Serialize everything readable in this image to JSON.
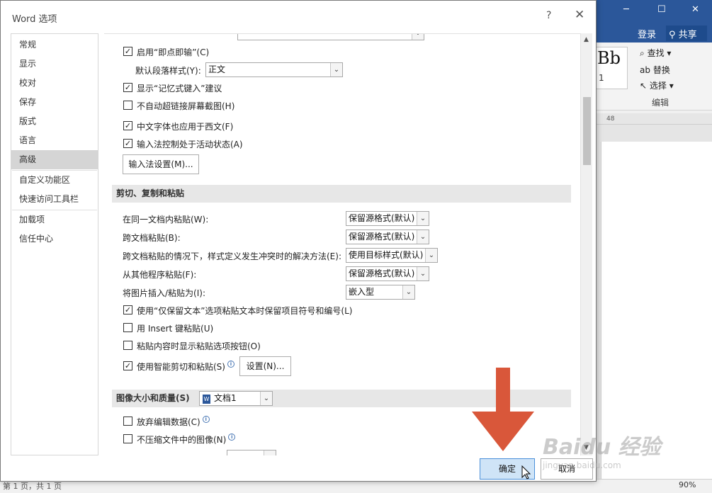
{
  "background_window": {
    "login_label": "登录",
    "share_label": "共享",
    "style_preview": "Bb",
    "style_preview_sub": "1",
    "find_label": "查找",
    "replace_label": "替换",
    "select_label": "选择",
    "edit_group_label": "编辑",
    "ruler_mark": "48",
    "zoom_level": "90%",
    "status_text": "第 1 页，共 1 页"
  },
  "dialog": {
    "title": "Word 选项",
    "help_glyph": "?",
    "close_glyph": "✕"
  },
  "nav": {
    "items": [
      {
        "label": "常规"
      },
      {
        "label": "显示"
      },
      {
        "label": "校对"
      },
      {
        "label": "保存"
      },
      {
        "label": "版式"
      },
      {
        "label": "语言"
      },
      {
        "label": "高级"
      },
      {
        "label": "自定义功能区"
      },
      {
        "label": "快速访问工具栏"
      },
      {
        "label": "加载项"
      },
      {
        "label": "信任中心"
      }
    ],
    "active_index": 6
  },
  "editing": {
    "click_and_type_label": "启用“即点即输”(C)",
    "default_para_style_label": "默认段落样式(Y):",
    "default_para_style_value": "正文",
    "autocomplete_label": "显示“记忆式键入”建议",
    "no_screenshot_hyperlink_label": "不自动超链接屏幕截图(H)",
    "chinese_font_western_label": "中文字体也应用于西文(F)",
    "ime_control_label": "输入法控制处于活动状态(A)",
    "ime_settings_button": "输入法设置(M)..."
  },
  "cut_copy_paste": {
    "section_title": "剪切、复制和粘贴",
    "rows": [
      {
        "label": "在同一文档内粘贴(W):",
        "value": "保留源格式(默认)"
      },
      {
        "label": "跨文档粘贴(B):",
        "value": "保留源格式(默认)"
      },
      {
        "label": "跨文档粘贴的情况下，样式定义发生冲突时的解决方法(E):",
        "value": "使用目标样式(默认)"
      },
      {
        "label": "从其他程序粘贴(F):",
        "value": "保留源格式(默认)"
      },
      {
        "label": "将图片插入/粘贴为(I):",
        "value": "嵌入型"
      }
    ],
    "keep_bullets_label": "使用“仅保留文本”选项粘贴文本时保留项目符号和编号(L)",
    "insert_key_paste_label": "用 Insert 键粘贴(U)",
    "show_paste_options_label": "粘贴内容时显示粘贴选项按钮(O)",
    "smart_cut_paste_label": "使用智能剪切和粘贴(S)",
    "settings_button": "设置(N)..."
  },
  "image_quality": {
    "section_title": "图像大小和质量(S)",
    "document_value": "文档1",
    "discard_edit_data_label": "放弃编辑数据(C)",
    "no_compress_label": "不压缩文件中的图像(N)"
  },
  "footer": {
    "ok_label": "确定",
    "cancel_label": "取消"
  },
  "watermark": {
    "brand": "Baidu 经验",
    "url": "jingyan.baidu.com"
  },
  "colors": {
    "word_blue": "#2b579a",
    "annotation_arrow": "#d9573a",
    "ok_button_fill": "#cfe4f7"
  }
}
